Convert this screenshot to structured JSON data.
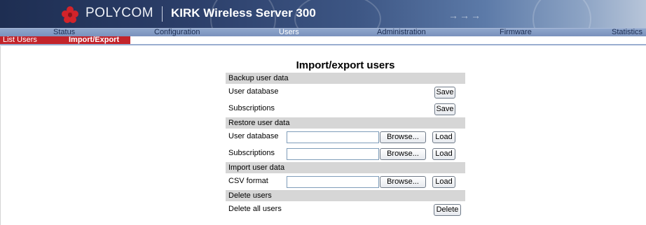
{
  "banner": {
    "brand": "POLYCOM",
    "product": "KIRK Wireless Server 300"
  },
  "main_nav": [
    "Status",
    "Configuration",
    "Users",
    "Administration",
    "Firmware",
    "Statistics"
  ],
  "main_nav_active": "Users",
  "sub_nav": [
    "List Users",
    "Import/Export"
  ],
  "sub_nav_active": "Import/Export",
  "colors": {
    "banner_blue": "#2c3f6a",
    "nav_blue": "#8fa6cc",
    "accent_red": "#c3242b",
    "section_gray": "#d6d6d6"
  },
  "page": {
    "title": "Import/export users",
    "sections": [
      {
        "title": "Backup user data",
        "rows": [
          {
            "label": "User database",
            "button": "Save"
          },
          {
            "label": "Subscriptions",
            "button": "Save"
          }
        ]
      },
      {
        "title": "Restore user data",
        "rows": [
          {
            "label": "User database",
            "browse": "Browse...",
            "button": "Load"
          },
          {
            "label": "Subscriptions",
            "browse": "Browse...",
            "button": "Load"
          }
        ]
      },
      {
        "title": "Import user data",
        "rows": [
          {
            "label": "CSV format",
            "browse": "Browse...",
            "button": "Load"
          }
        ]
      },
      {
        "title": "Delete users",
        "rows": [
          {
            "label": "Delete all users",
            "button": "Delete"
          }
        ]
      }
    ]
  }
}
